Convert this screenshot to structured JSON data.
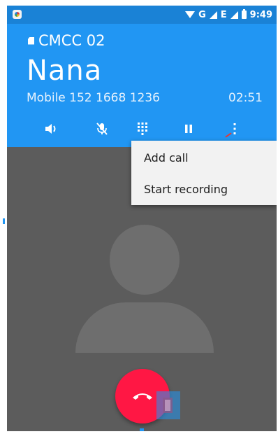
{
  "status_bar": {
    "time": "9:49",
    "network_g": "G",
    "network_e": "E",
    "icons": [
      "app-notification-icon",
      "wifi-icon",
      "signal-g-icon",
      "signal-e-icon",
      "battery-icon"
    ]
  },
  "call": {
    "sim_label": "CMCC 02",
    "contact_name": "Nana",
    "phone_line": "Mobile 152 1668 1236",
    "timer": "02:51"
  },
  "controls": [
    {
      "name": "speaker-icon"
    },
    {
      "name": "mute-icon"
    },
    {
      "name": "dialpad-icon"
    },
    {
      "name": "hold-icon"
    },
    {
      "name": "more-options-icon"
    }
  ],
  "menu": {
    "items": [
      {
        "label": "Add call"
      },
      {
        "label": "Start recording"
      }
    ]
  },
  "colors": {
    "header_blue": "#2196f3",
    "status_blue": "#1a82d6",
    "end_call_red": "#ff1744",
    "background_gray": "#5c5c5c",
    "avatar_gray": "#6e6e6e"
  }
}
